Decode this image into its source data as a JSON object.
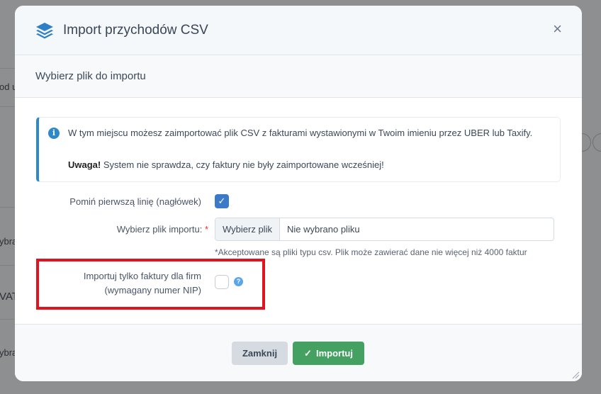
{
  "background": {
    "fragments": [
      "od u",
      "ybra",
      "VAT",
      "ybra"
    ]
  },
  "modal": {
    "title": "Import przychodów CSV",
    "close_symbol": "×",
    "section_title": "Wybierz plik do importu",
    "info": {
      "text": "W tym miejscu możesz zaimportować plik CSV z fakturami wystawionymi w Twoim imieniu przez UBER lub Taxify.",
      "warning_bold": "Uwaga!",
      "warning_text": " System nie sprawdza, czy faktury nie były zaimportowane wcześniej!"
    },
    "form": {
      "skip_header_label": "Pomiń pierwszą linię (nagłówek)",
      "skip_header_checked": true,
      "file_label": "Wybierz plik importu:",
      "required_mark": "*",
      "file_button": "Wybierz plik",
      "file_placeholder": "Nie wybrano pliku",
      "file_hint": "*Akceptowane są pliki typu csv. Plik może zawierać dane nie więcej niż 4000 faktur",
      "firms_only_label_line1": "Importuj tylko faktury dla firm",
      "firms_only_label_line2": "(wymagany numer NIP)",
      "firms_only_checked": false,
      "help_symbol": "?"
    },
    "footer": {
      "close_button": "Zamknij",
      "import_button": "Importuj"
    }
  },
  "colors": {
    "accent_blue": "#3b7ac9",
    "success_green": "#45a162",
    "highlight_red": "#e0141e"
  }
}
